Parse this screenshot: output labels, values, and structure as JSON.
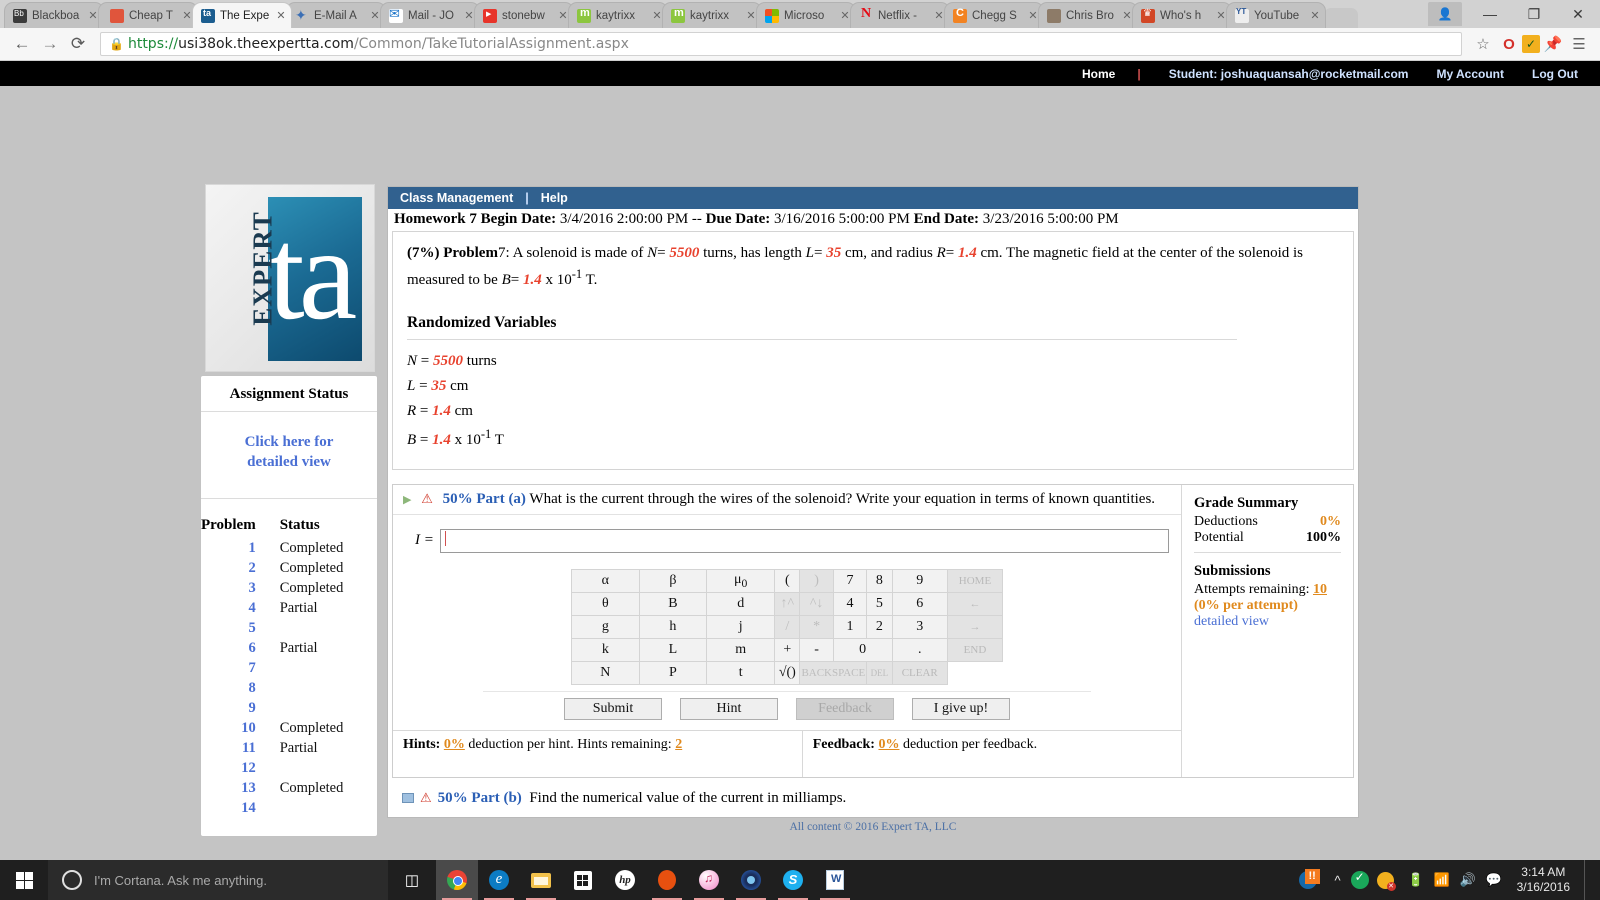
{
  "browser": {
    "tabs": [
      {
        "favicon": "blackboard-icon",
        "label": "Blackboa",
        "active": false
      },
      {
        "favicon": "cheap-icon",
        "label": "Cheap T",
        "active": false
      },
      {
        "favicon": "expert-ta-icon",
        "label": "The Expe",
        "active": true
      },
      {
        "favicon": "email-icon",
        "label": "E-Mail A",
        "active": false
      },
      {
        "favicon": "mail-icon",
        "label": "Mail - JO",
        "active": false
      },
      {
        "favicon": "stonebw-icon",
        "label": "stonebw",
        "active": false
      },
      {
        "favicon": "kaytrixx-icon",
        "label": "kaytrixx",
        "active": false
      },
      {
        "favicon": "kaytrixx-icon",
        "label": "kaytrixx",
        "active": false
      },
      {
        "favicon": "microsoft-icon",
        "label": "Microso",
        "active": false
      },
      {
        "favicon": "netflix-icon",
        "label": "Netflix -",
        "active": false
      },
      {
        "favicon": "chegg-icon",
        "label": "Chegg S",
        "active": false
      },
      {
        "favicon": "chris-avatar-icon",
        "label": "Chris Bro",
        "active": false
      },
      {
        "favicon": "whos-icon",
        "label": "Who's h",
        "active": false
      },
      {
        "favicon": "youtube-mp3-icon",
        "label": "YouTube",
        "active": false
      }
    ],
    "tab_close_glyph": "✕",
    "window_controls": {
      "minimize": "—",
      "maximize": "❐",
      "close": "✕",
      "profile": "●"
    },
    "nav": {
      "back": "←",
      "forward": "→",
      "reload": "⟳"
    },
    "url": {
      "lock": "ὑ2",
      "scheme": "https://",
      "host": "usi38ok.theexpertta.com",
      "path": "/Common/TakeTutorialAssignment.aspx"
    },
    "omni_icons": [
      "star-icon",
      "opera-icon",
      "avast-icon",
      "pin-icon",
      "menu-icon"
    ]
  },
  "sitenav": {
    "home": "Home",
    "separator": "|",
    "student": "Student: joshuaquansah@rocketmail.com",
    "my_account": "My Account",
    "log_out": "Log Out"
  },
  "logo": {
    "word": "EXPERT",
    "mark": "ta"
  },
  "sidebar": {
    "title": "Assignment Status",
    "detailed_view_line1": "Click here for",
    "detailed_view_line2": "detailed view",
    "col_problem": "Problem",
    "col_status": "Status",
    "rows": [
      {
        "num": "1",
        "status": "Completed"
      },
      {
        "num": "2",
        "status": "Completed"
      },
      {
        "num": "3",
        "status": "Completed"
      },
      {
        "num": "4",
        "status": "Partial"
      },
      {
        "num": "5",
        "status": ""
      },
      {
        "num": "6",
        "status": "Partial"
      },
      {
        "num": "7",
        "status": ""
      },
      {
        "num": "8",
        "status": ""
      },
      {
        "num": "9",
        "status": ""
      },
      {
        "num": "10",
        "status": "Completed"
      },
      {
        "num": "11",
        "status": "Partial"
      },
      {
        "num": "12",
        "status": ""
      },
      {
        "num": "13",
        "status": "Completed"
      },
      {
        "num": "14",
        "status": ""
      }
    ]
  },
  "content": {
    "menu": {
      "class_management": "Class Management",
      "pipe": "|",
      "help": "Help"
    },
    "homework": {
      "title": "Homework 7",
      "begin_label": "Begin Date:",
      "begin_value": "3/4/2016 2:00:00 PM",
      "dash": "--",
      "due_label": "Due Date:",
      "due_value": "3/16/2016 5:00:00 PM",
      "end_label": "End Date:",
      "end_value": "3/23/2016 5:00:00 PM"
    },
    "problem": {
      "weight": "(7%)",
      "label": "Problem",
      "number": "7:",
      "text_1": "A solenoid is made of",
      "n_sym": "N",
      "eq": "=",
      "n_val": "5500",
      "text_2": "turns, has length",
      "l_sym": "L",
      "l_val": "35",
      "text_3": "cm, and radius",
      "r_sym": "R",
      "r_val": "1.4",
      "text_4": "cm. The magnetic field at the center of the solenoid is measured to be",
      "b_sym": "B",
      "b_val": "1.4",
      "b_tail": "x 10",
      "b_exp": "-1",
      "b_unit": "T."
    },
    "randomized": {
      "title": "Randomized Variables",
      "lines": [
        {
          "sym": "N",
          "val": "5500",
          "unit": "turns"
        },
        {
          "sym": "L",
          "val": "35",
          "unit": "cm"
        },
        {
          "sym": "R",
          "val": "1.4",
          "unit": "cm"
        },
        {
          "sym": "B",
          "val": "1.4",
          "unit": "x 10",
          "exp": "-1",
          "unit2": "T"
        }
      ]
    },
    "part_a": {
      "percent": "50%",
      "label": "Part (a)",
      "question": "What is the current through the wires of the solenoid? Write your equation in terms of known quantities.",
      "answer_label": "I =",
      "answer_value": ""
    },
    "keypad": {
      "rows": [
        [
          "α",
          "β",
          "μ0",
          "(",
          ")",
          "7",
          "8",
          "9",
          "HOME"
        ],
        [
          "θ",
          "B",
          "d",
          "↑^",
          "^↓",
          "4",
          "5",
          "6",
          "←"
        ],
        [
          "g",
          "h",
          "j",
          "/",
          "*",
          "1",
          "2",
          "3",
          "→"
        ],
        [
          "k",
          "L",
          "m",
          "+",
          "-",
          "0",
          ".",
          "END"
        ],
        [
          "N",
          "P",
          "t",
          "√()",
          "BACKSPACE",
          "DEL",
          "CLEAR"
        ]
      ]
    },
    "buttons": {
      "submit": "Submit",
      "hint": "Hint",
      "feedback": "Feedback",
      "give_up": "I give up!"
    },
    "hints": {
      "label": "Hints:",
      "percent": "0%",
      "text": "deduction per hint. Hints remaining:",
      "remaining": "2"
    },
    "feedback_note": {
      "label": "Feedback:",
      "percent": "0%",
      "text": "deduction per feedback."
    },
    "grade_summary": {
      "title": "Grade Summary",
      "deductions_label": "Deductions",
      "deductions_value": "0%",
      "potential_label": "Potential",
      "potential_value": "100%",
      "submissions_title": "Submissions",
      "attempts_label": "Attempts remaining:",
      "attempts_value": "10",
      "per_attempt": "(0% per attempt)",
      "detailed_view": "detailed view"
    },
    "part_b": {
      "percent": "50%",
      "label": "Part (b)",
      "question": "Find the numerical value of the current in milliamps."
    },
    "footer": "All content © 2016 Expert TA, LLC"
  },
  "taskbar": {
    "start": "start-button",
    "cortana_placeholder": "I'm Cortana. Ask me anything.",
    "task_view": "task-view-button",
    "apps": [
      {
        "name": "chrome",
        "active": true
      },
      {
        "name": "edge",
        "active": false
      },
      {
        "name": "file-explorer",
        "active": false
      },
      {
        "name": "store",
        "active": false
      },
      {
        "name": "hp",
        "active": false
      },
      {
        "name": "opera",
        "active": false
      },
      {
        "name": "itunes",
        "active": false
      },
      {
        "name": "blue-app",
        "active": false
      },
      {
        "name": "skype",
        "active": false
      },
      {
        "name": "word",
        "active": false
      }
    ],
    "tray": [
      "avast-icon",
      "chevron-up-icon",
      "dropbox-icon",
      "ccleaner-icon",
      "battery-icon",
      "wifi-icon",
      "volume-icon",
      "action-center-icon"
    ],
    "time": "3:14 AM",
    "date": "3/16/2016"
  },
  "colors": {
    "accent_blue": "#31618f",
    "link_blue": "#4a6fd4",
    "var_red": "#e8422e",
    "orange": "#e08a1e",
    "taskbar": "#1f1f1f"
  }
}
